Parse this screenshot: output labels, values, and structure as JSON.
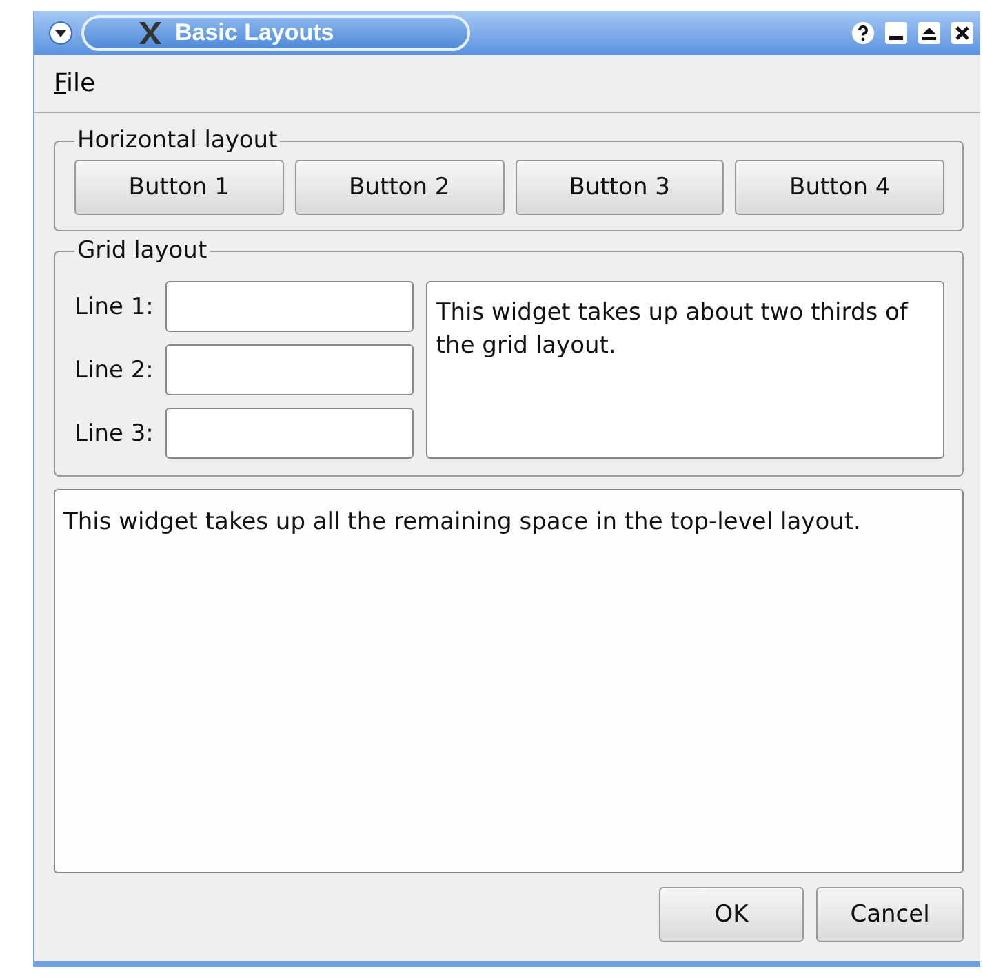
{
  "window": {
    "title": "Basic Layouts"
  },
  "menu": [
    {
      "label": "File"
    }
  ],
  "horizontal_group": {
    "title": "Horizontal layout",
    "buttons": [
      "Button 1",
      "Button 2",
      "Button 3",
      "Button 4"
    ]
  },
  "grid_group": {
    "title": "Grid layout",
    "fields": [
      {
        "label": "Line 1:"
      },
      {
        "label": "Line 2:"
      },
      {
        "label": "Line 3:"
      }
    ],
    "note": "This widget takes up about two thirds of the grid layout."
  },
  "text_area": "This widget takes up all the remaining space in the top-level layout.",
  "dialog_buttons": [
    "OK",
    "Cancel"
  ]
}
